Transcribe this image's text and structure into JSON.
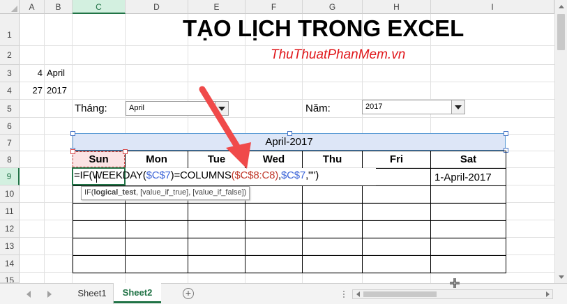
{
  "columns": [
    "A",
    "B",
    "C",
    "D",
    "E",
    "F",
    "G",
    "H",
    "I"
  ],
  "rows": [
    "1",
    "2",
    "3",
    "4",
    "5",
    "6",
    "7",
    "8",
    "9",
    "10",
    "11",
    "12",
    "13",
    "14",
    "15"
  ],
  "sheet": {
    "title": "TẠO LỊCH TRONG EXCEL",
    "watermark": "ThuThuatPhanMem.vn",
    "a3": "4",
    "b3": "April",
    "a4": "27",
    "b4": "2017",
    "month_label": "Tháng:",
    "month_value": "April",
    "year_label": "Năm:",
    "year_value": "2017",
    "banner": "April-2017",
    "days": [
      "Sun",
      "Mon",
      "Tue",
      "Wed",
      "Thu",
      "Fri",
      "Sat"
    ],
    "i9": "1-April-2017"
  },
  "formula": {
    "p1": "=IF(",
    "p2": "WEEKDAY(",
    "p3": "$C$7",
    "p4": ")=COLUMNS",
    "p5": "($C$8:C8)",
    "p6": ",",
    "p7": "$C$7",
    "p8": ",\"\")"
  },
  "tooltip": {
    "fn": "IF(",
    "arg1": "logical_test",
    "rest": ", [value_if_true], [value_if_false])"
  },
  "tabs": {
    "sheet1": "Sheet1",
    "sheet2": "Sheet2",
    "add": "+"
  },
  "colors": {
    "accent": "#217346",
    "arrow": "#f04a4a",
    "banner_fill": "#dde6f7",
    "watermark": "#e0161a"
  }
}
